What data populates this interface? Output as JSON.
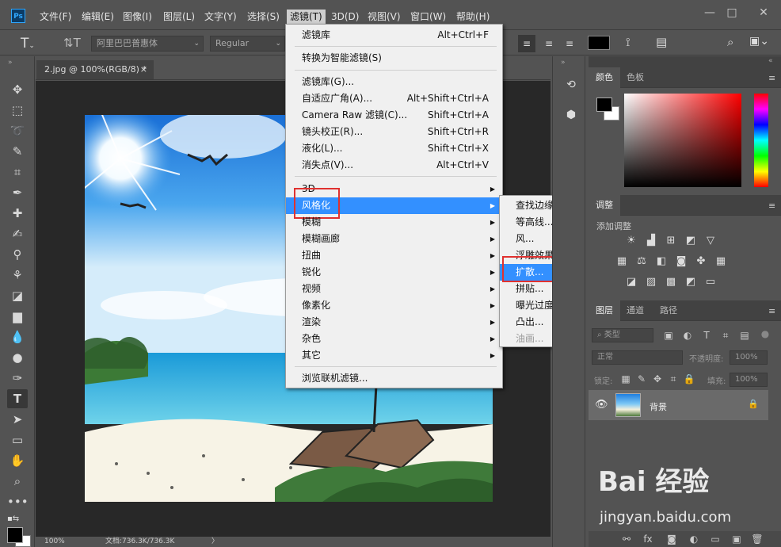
{
  "menubar": {
    "items": [
      "文件(F)",
      "编辑(E)",
      "图像(I)",
      "图层(L)",
      "文字(Y)",
      "选择(S)",
      "滤镜(T)",
      "3D(D)",
      "视图(V)",
      "窗口(W)",
      "帮助(H)"
    ],
    "logo": "Ps",
    "window_controls": [
      "—",
      "□",
      "✕"
    ]
  },
  "options_bar": {
    "font_family": "阿里巴巴普惠体",
    "font_style": "Regular",
    "text_color": "#000000"
  },
  "document": {
    "tab_title": "2.jpg @ 100%(RGB/8) *",
    "tab_close": "×",
    "status_zoom": "100%",
    "status_doc": "文档:736.3K/736.3K",
    "status_arrow": "〉"
  },
  "filter_menu": {
    "items": [
      {
        "label": "滤镜库",
        "shortcut": "Alt+Ctrl+F"
      },
      {
        "label": "转换为智能滤镜(S)",
        "shortcut": ""
      },
      {
        "label": "滤镜库(G)...",
        "shortcut": ""
      },
      {
        "label": "自适应广角(A)...",
        "shortcut": "Alt+Shift+Ctrl+A"
      },
      {
        "label": "Camera Raw 滤镜(C)...",
        "shortcut": "Shift+Ctrl+A"
      },
      {
        "label": "镜头校正(R)...",
        "shortcut": "Shift+Ctrl+R"
      },
      {
        "label": "液化(L)...",
        "shortcut": "Shift+Ctrl+X"
      },
      {
        "label": "消失点(V)...",
        "shortcut": "Alt+Ctrl+V"
      },
      {
        "label": "3D",
        "shortcut": ""
      },
      {
        "label": "风格化",
        "shortcut": ""
      },
      {
        "label": "模糊",
        "shortcut": ""
      },
      {
        "label": "模糊画廊",
        "shortcut": ""
      },
      {
        "label": "扭曲",
        "shortcut": ""
      },
      {
        "label": "锐化",
        "shortcut": ""
      },
      {
        "label": "视频",
        "shortcut": ""
      },
      {
        "label": "像素化",
        "shortcut": ""
      },
      {
        "label": "渲染",
        "shortcut": ""
      },
      {
        "label": "杂色",
        "shortcut": ""
      },
      {
        "label": "其它",
        "shortcut": ""
      },
      {
        "label": "浏览联机滤镜...",
        "shortcut": ""
      }
    ]
  },
  "stylize_submenu": {
    "items": [
      "查找边缘",
      "等高线...",
      "风...",
      "浮雕效果...",
      "扩散...",
      "拼贴...",
      "曝光过度",
      "凸出...",
      "油画..."
    ]
  },
  "color_panel": {
    "tabs": [
      "颜色",
      "色板"
    ],
    "foreground": "#000000",
    "background": "#ffffff",
    "hue_color": "#ff0000"
  },
  "adjustments_panel": {
    "tab": "调整",
    "subtitle": "添加调整"
  },
  "layers_panel": {
    "tabs": [
      "图层",
      "通道",
      "路径"
    ],
    "filter_kind": "类型",
    "blend_mode": "正常",
    "opacity_label": "不透明度:",
    "opacity_value": "100%",
    "lock_label": "锁定:",
    "fill_label": "填充:",
    "fill_value": "100%",
    "layer_name": "背景"
  },
  "watermark": {
    "brand": "Bai 经验",
    "url": "jingyan.baidu.com"
  }
}
